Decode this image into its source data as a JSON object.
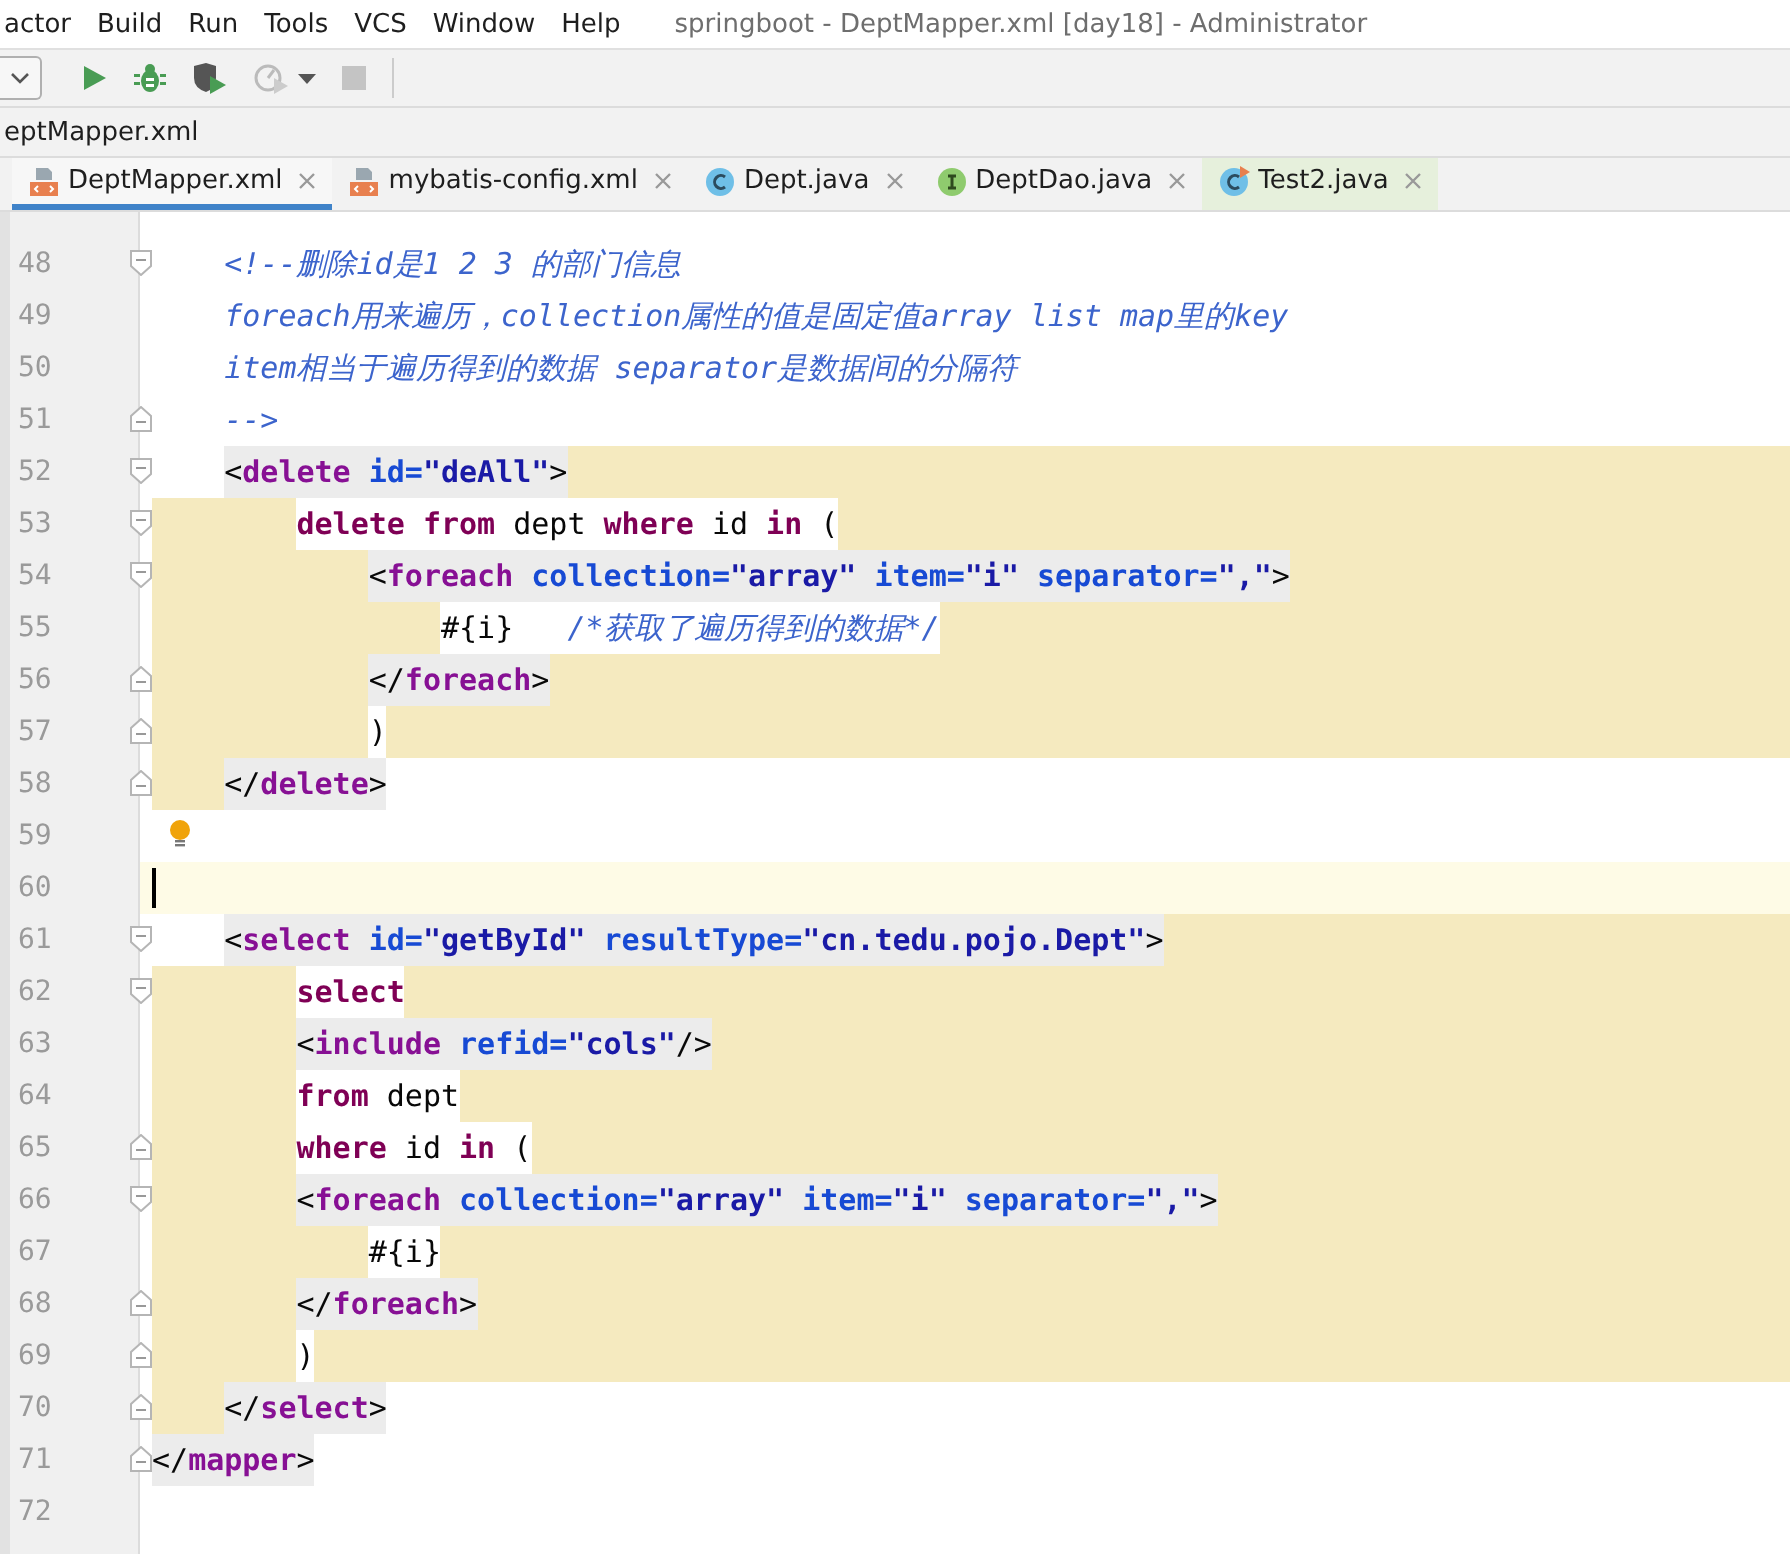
{
  "menu": [
    {
      "label": "actor"
    },
    {
      "label": "Build"
    },
    {
      "label": "Run"
    },
    {
      "label": "Tools"
    },
    {
      "label": "VCS"
    },
    {
      "label": "Window"
    },
    {
      "label": "Help"
    }
  ],
  "window": {
    "title": "springboot - DeptMapper.xml [day18] - Administrator"
  },
  "toolbar": [
    {
      "kind": "dropdown"
    },
    {
      "kind": "run",
      "disabled": false
    },
    {
      "kind": "debug",
      "disabled": false
    },
    {
      "kind": "coverage",
      "disabled": false
    },
    {
      "kind": "profile",
      "disabled": true
    },
    {
      "kind": "caret",
      "disabled": false
    },
    {
      "kind": "stop",
      "disabled": true
    }
  ],
  "breadcrumb": "eptMapper.xml",
  "tabs": [
    {
      "label": "DeptMapper.xml",
      "kind": "xml",
      "selected": true
    },
    {
      "label": "mybatis-config.xml",
      "kind": "xml",
      "selected": false
    },
    {
      "label": "Dept.java",
      "kind": "class",
      "selected": false
    },
    {
      "label": "DeptDao.java",
      "kind": "interface",
      "selected": false
    },
    {
      "label": "Test2.java",
      "kind": "runclass",
      "selected": false
    }
  ],
  "lines": [
    {
      "n": "48",
      "fold_open": true,
      "tokens": [
        {
          "kind": "comment",
          "t": "    <!--删除id是1 2 3 的部门信息"
        }
      ]
    },
    {
      "n": "49",
      "tokens": [
        {
          "kind": "comment",
          "t": "    foreach用来遍历，collection属性的值是固定值array list map里的key"
        }
      ]
    },
    {
      "n": "50",
      "tokens": [
        {
          "kind": "comment",
          "t": "    item相当于遍历得到的数据 separator是数据间的分隔符"
        }
      ]
    },
    {
      "n": "51",
      "fold_close": true,
      "tokens": [
        {
          "kind": "comment",
          "t": "    -->"
        }
      ]
    },
    {
      "n": "52",
      "fold_open": true,
      "scope_after": true,
      "matched": true,
      "tokens": [
        {
          "kind": "punct",
          "t": "    <"
        },
        {
          "kind": "tag",
          "t": "delete"
        },
        {
          "kind": "attr",
          "t": " id="
        },
        {
          "kind": "value",
          "t": "\"deAll\""
        },
        {
          "kind": "punct",
          "t": ">"
        }
      ]
    },
    {
      "n": "53",
      "fold_open": true,
      "scope_before": true,
      "scope_after": true,
      "tokens": [
        {
          "kind": "kw",
          "t": "        delete"
        },
        {
          "kind": "kw",
          "t": " from"
        },
        {
          "kind": "plain",
          "t": " dept "
        },
        {
          "kind": "kw",
          "t": "where"
        },
        {
          "kind": "plain",
          "t": " id "
        },
        {
          "kind": "kw",
          "t": "in"
        },
        {
          "kind": "plain",
          "t": " ("
        }
      ]
    },
    {
      "n": "54",
      "fold_open": true,
      "scope_before": true,
      "scope_after": true,
      "matched": true,
      "tokens": [
        {
          "kind": "punct",
          "t": "            <"
        },
        {
          "kind": "tag",
          "t": "foreach"
        },
        {
          "kind": "attr",
          "t": " collection="
        },
        {
          "kind": "value",
          "t": "\"array\""
        },
        {
          "kind": "attr",
          "t": " item="
        },
        {
          "kind": "value",
          "t": "\"i\""
        },
        {
          "kind": "attr",
          "t": " separator="
        },
        {
          "kind": "value",
          "t": "\",\""
        },
        {
          "kind": "punct",
          "t": ">"
        }
      ]
    },
    {
      "n": "55",
      "scope_before": true,
      "scope_after": true,
      "tokens": [
        {
          "kind": "plain",
          "t": "                #{i}   "
        },
        {
          "kind": "comment",
          "t": "/*获取了遍历得到的数据*/"
        }
      ]
    },
    {
      "n": "56",
      "fold_close": true,
      "scope_before": true,
      "scope_after": true,
      "matched": true,
      "tokens": [
        {
          "kind": "punct",
          "t": "            </"
        },
        {
          "kind": "tag",
          "t": "foreach"
        },
        {
          "kind": "punct",
          "t": ">"
        }
      ]
    },
    {
      "n": "57",
      "fold_close": true,
      "scope_before": true,
      "scope_after": true,
      "tokens": [
        {
          "kind": "plain",
          "t": "            )"
        }
      ]
    },
    {
      "n": "58",
      "fold_close": true,
      "scope_before": true,
      "matched": true,
      "tokens": [
        {
          "kind": "punct",
          "t": "    </"
        },
        {
          "kind": "tag",
          "t": "delete"
        },
        {
          "kind": "punct",
          "t": ">"
        }
      ]
    },
    {
      "n": "59",
      "bulb": true
    },
    {
      "n": "60",
      "current": true
    },
    {
      "n": "61",
      "fold_open": true,
      "scope_after": true,
      "matched": true,
      "tokens": [
        {
          "kind": "punct",
          "t": "    <"
        },
        {
          "kind": "tag",
          "t": "select"
        },
        {
          "kind": "attr",
          "t": " id="
        },
        {
          "kind": "value",
          "t": "\"getById\""
        },
        {
          "kind": "attr",
          "t": " resultType="
        },
        {
          "kind": "value",
          "t": "\"cn.tedu.pojo.Dept\""
        },
        {
          "kind": "punct",
          "t": ">"
        }
      ]
    },
    {
      "n": "62",
      "fold_open": true,
      "scope_before": true,
      "scope_after": true,
      "tokens": [
        {
          "kind": "kw",
          "t": "        select"
        }
      ]
    },
    {
      "n": "63",
      "scope_before": true,
      "scope_after": true,
      "matched": true,
      "tokens": [
        {
          "kind": "punct",
          "t": "        <"
        },
        {
          "kind": "tag",
          "t": "include"
        },
        {
          "kind": "attr",
          "t": " refid="
        },
        {
          "kind": "value",
          "t": "\"cols\""
        },
        {
          "kind": "punct",
          "t": "/>"
        }
      ]
    },
    {
      "n": "64",
      "scope_before": true,
      "scope_after": true,
      "tokens": [
        {
          "kind": "kw",
          "t": "        from"
        },
        {
          "kind": "plain",
          "t": " dept"
        }
      ]
    },
    {
      "n": "65",
      "fold_close": true,
      "scope_before": true,
      "scope_after": true,
      "tokens": [
        {
          "kind": "kw",
          "t": "        where"
        },
        {
          "kind": "plain",
          "t": " id "
        },
        {
          "kind": "kw",
          "t": "in"
        },
        {
          "kind": "plain",
          "t": " ("
        }
      ]
    },
    {
      "n": "66",
      "fold_open": true,
      "scope_before": true,
      "scope_after": true,
      "matched": true,
      "tokens": [
        {
          "kind": "punct",
          "t": "        <"
        },
        {
          "kind": "tag",
          "t": "foreach"
        },
        {
          "kind": "attr",
          "t": " collection="
        },
        {
          "kind": "value",
          "t": "\"array\""
        },
        {
          "kind": "attr",
          "t": " item="
        },
        {
          "kind": "value",
          "t": "\"i\""
        },
        {
          "kind": "attr",
          "t": " separator="
        },
        {
          "kind": "value",
          "t": "\",\""
        },
        {
          "kind": "punct",
          "t": ">"
        }
      ]
    },
    {
      "n": "67",
      "scope_before": true,
      "scope_after": true,
      "tokens": [
        {
          "kind": "plain",
          "t": "            #{i}"
        }
      ]
    },
    {
      "n": "68",
      "fold_close": true,
      "scope_before": true,
      "scope_after": true,
      "matched": true,
      "tokens": [
        {
          "kind": "punct",
          "t": "        </"
        },
        {
          "kind": "tag",
          "t": "foreach"
        },
        {
          "kind": "punct",
          "t": ">"
        }
      ]
    },
    {
      "n": "69",
      "fold_close": true,
      "scope_before": true,
      "scope_after": true,
      "tokens": [
        {
          "kind": "plain",
          "t": "        )"
        }
      ]
    },
    {
      "n": "70",
      "fold_close": true,
      "scope_before": true,
      "matched": true,
      "tokens": [
        {
          "kind": "punct",
          "t": "    </"
        },
        {
          "kind": "tag",
          "t": "select"
        },
        {
          "kind": "punct",
          "t": ">"
        }
      ]
    },
    {
      "n": "71",
      "fold_close": true,
      "matched": true,
      "tokens": [
        {
          "kind": "punct",
          "t": "</"
        },
        {
          "kind": "tag",
          "t": "mapper"
        },
        {
          "kind": "punct",
          "t": ">"
        }
      ]
    },
    {
      "n": "72"
    }
  ]
}
